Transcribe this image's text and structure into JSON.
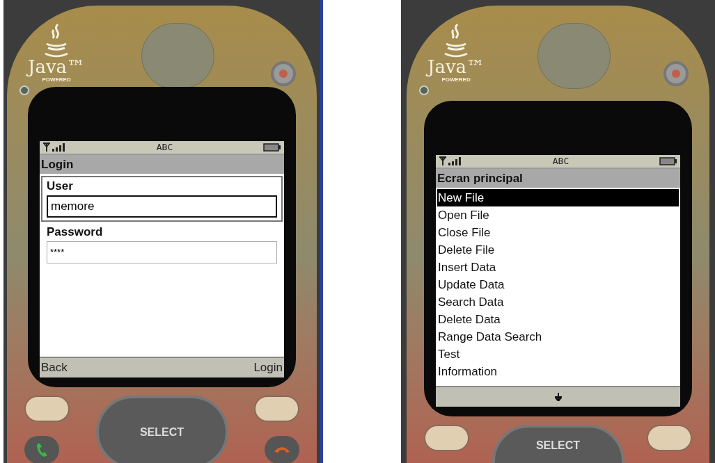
{
  "phones": [
    {
      "logo": {
        "name": "Java™",
        "tagline": "POWERED"
      },
      "status_bar": {
        "input_mode": "ABC"
      },
      "keypad": {
        "select_label": "SELECT"
      },
      "screen": {
        "kind": "form",
        "title": "Login",
        "fields": [
          {
            "label": "User",
            "value": "memore",
            "focused": true
          },
          {
            "label": "Password",
            "value": "****",
            "focused": false
          }
        ],
        "softkeys": {
          "left": "Back",
          "right": "Login"
        }
      }
    },
    {
      "logo": {
        "name": "Java™",
        "tagline": "POWERED"
      },
      "status_bar": {
        "input_mode": "ABC"
      },
      "keypad": {
        "select_label": "SELECT"
      },
      "screen": {
        "kind": "list",
        "title": "Ecran principal",
        "items": [
          {
            "label": "New File",
            "selected": true
          },
          {
            "label": "Open File",
            "selected": false
          },
          {
            "label": "Close File",
            "selected": false
          },
          {
            "label": "Delete File",
            "selected": false
          },
          {
            "label": "Insert Data",
            "selected": false
          },
          {
            "label": "Update Data",
            "selected": false
          },
          {
            "label": "Search Data",
            "selected": false
          },
          {
            "label": "Delete Data",
            "selected": false
          },
          {
            "label": "Range Data Search",
            "selected": false
          },
          {
            "label": "Test",
            "selected": false
          },
          {
            "label": "Information",
            "selected": false
          }
        ],
        "more_below": true
      }
    }
  ]
}
